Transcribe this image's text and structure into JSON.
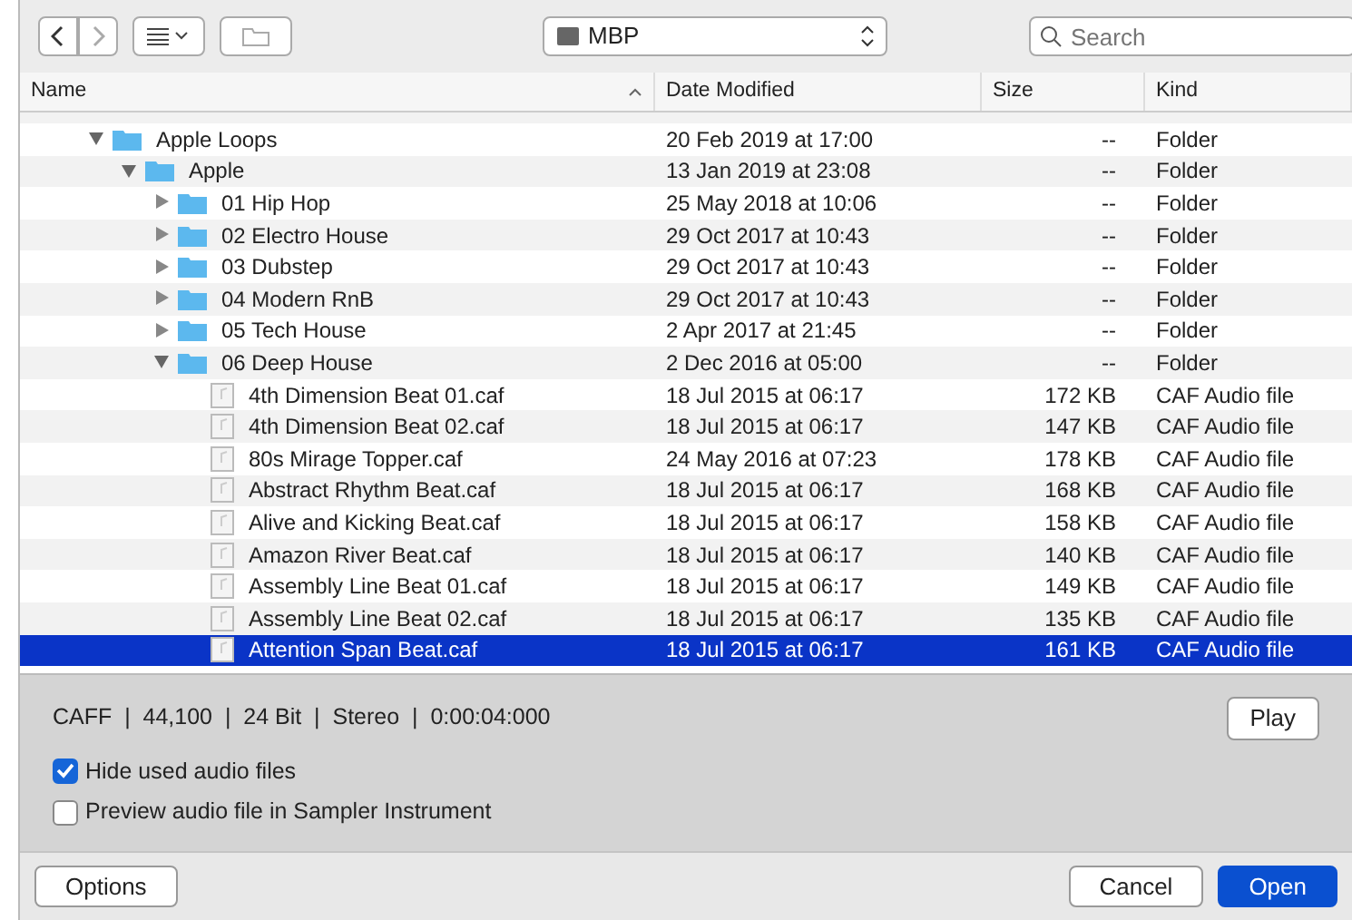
{
  "toolbar": {
    "location": "MBP",
    "search": {
      "placeholder": "Search"
    }
  },
  "columns": [
    {
      "label": "Name",
      "sorted": true
    },
    {
      "label": "Date Modified",
      "sorted": false
    },
    {
      "label": "Size",
      "sorted": false
    },
    {
      "label": "Kind",
      "sorted": false
    }
  ],
  "tree": [
    {
      "name": "Apple Loops",
      "kind": "folder",
      "expanded": true,
      "selected": false,
      "date": "20 Feb 2019 at 17:00",
      "size": "--",
      "type": "Folder",
      "children": [
        {
          "name": "Apple",
          "kind": "folder",
          "expanded": true,
          "selected": false,
          "date": "13 Jan 2019 at 23:08",
          "size": "--",
          "type": "Folder",
          "children": [
            {
              "name": "01 Hip Hop",
              "kind": "folder",
              "expanded": false,
              "selected": false,
              "date": "25 May 2018 at 10:06",
              "size": "--",
              "type": "Folder"
            },
            {
              "name": "02 Electro House",
              "kind": "folder",
              "expanded": false,
              "selected": false,
              "date": "29 Oct 2017 at 10:43",
              "size": "--",
              "type": "Folder"
            },
            {
              "name": "03 Dubstep",
              "kind": "folder",
              "expanded": false,
              "selected": false,
              "date": "29 Oct 2017 at 10:43",
              "size": "--",
              "type": "Folder"
            },
            {
              "name": "04 Modern RnB",
              "kind": "folder",
              "expanded": false,
              "selected": false,
              "date": "29 Oct 2017 at 10:43",
              "size": "--",
              "type": "Folder"
            },
            {
              "name": "05 Tech House",
              "kind": "folder",
              "expanded": false,
              "selected": false,
              "date": "2 Apr 2017 at 21:45",
              "size": "--",
              "type": "Folder"
            },
            {
              "name": "06 Deep House",
              "kind": "folder",
              "expanded": true,
              "selected": false,
              "date": "2 Dec 2016 at 05:00",
              "size": "--",
              "type": "Folder",
              "children": [
                {
                  "name": "4th Dimension Beat 01.caf",
                  "kind": "file",
                  "selected": false,
                  "date": "18 Jul 2015 at 06:17",
                  "size": "172 KB",
                  "type": "CAF Audio file"
                },
                {
                  "name": "4th Dimension Beat 02.caf",
                  "kind": "file",
                  "selected": false,
                  "date": "18 Jul 2015 at 06:17",
                  "size": "147 KB",
                  "type": "CAF Audio file"
                },
                {
                  "name": "80s Mirage Topper.caf",
                  "kind": "file",
                  "selected": false,
                  "date": "24 May 2016 at 07:23",
                  "size": "178 KB",
                  "type": "CAF Audio file"
                },
                {
                  "name": "Abstract Rhythm Beat.caf",
                  "kind": "file",
                  "selected": false,
                  "date": "18 Jul 2015 at 06:17",
                  "size": "168 KB",
                  "type": "CAF Audio file"
                },
                {
                  "name": "Alive and Kicking Beat.caf",
                  "kind": "file",
                  "selected": false,
                  "date": "18 Jul 2015 at 06:17",
                  "size": "158 KB",
                  "type": "CAF Audio file"
                },
                {
                  "name": "Amazon River Beat.caf",
                  "kind": "file",
                  "selected": false,
                  "date": "18 Jul 2015 at 06:17",
                  "size": "140 KB",
                  "type": "CAF Audio file"
                },
                {
                  "name": "Assembly Line Beat 01.caf",
                  "kind": "file",
                  "selected": false,
                  "date": "18 Jul 2015 at 06:17",
                  "size": "149 KB",
                  "type": "CAF Audio file"
                },
                {
                  "name": "Assembly Line Beat 02.caf",
                  "kind": "file",
                  "selected": false,
                  "date": "18 Jul 2015 at 06:17",
                  "size": "135 KB",
                  "type": "CAF Audio file"
                },
                {
                  "name": "Attention Span Beat.caf",
                  "kind": "file",
                  "selected": true,
                  "date": "18 Jul 2015 at 06:17",
                  "size": "161 KB",
                  "type": "CAF Audio file"
                }
              ]
            }
          ]
        }
      ]
    }
  ],
  "info": "CAFF  |  44,100  |  24 Bit  |  Stereo  |  0:00:04:000",
  "play_button": "Play",
  "options": [
    {
      "label": "Hide used audio files",
      "checked": true
    },
    {
      "label": "Preview audio file in Sampler Instrument",
      "checked": false
    }
  ],
  "buttons": [
    {
      "label": "Options",
      "kind": "plain"
    },
    {
      "label": "Cancel",
      "kind": "plain"
    },
    {
      "label": "Open",
      "kind": "default"
    }
  ]
}
